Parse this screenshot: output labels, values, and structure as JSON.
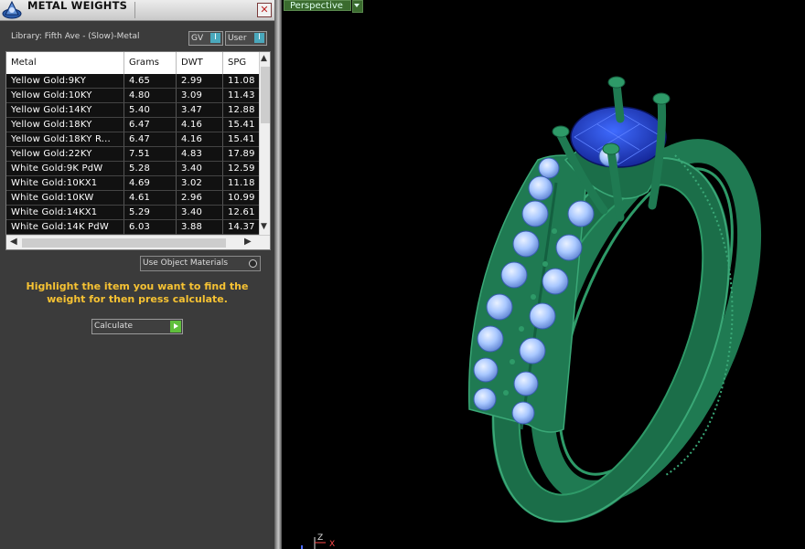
{
  "panel": {
    "title": "METAL WEIGHTS",
    "close_label": "✕",
    "library_label": "Library: Fifth Ave - (Slow)-Metal",
    "gv_toggle": "GV",
    "user_toggle": "User",
    "use_object_materials": "Use Object Materials",
    "instructions": "Highlight the item you want to find the weight for then press calculate.",
    "calculate_label": "Calculate"
  },
  "table": {
    "columns": [
      "Metal",
      "Grams",
      "DWT",
      "SPG"
    ],
    "rows": [
      [
        "Yellow Gold:9KY",
        "4.65",
        "2.99",
        "11.08"
      ],
      [
        "Yellow Gold:10KY",
        "4.80",
        "3.09",
        "11.43"
      ],
      [
        "Yellow Gold:14KY",
        "5.40",
        "3.47",
        "12.88"
      ],
      [
        "Yellow Gold:18KY",
        "6.47",
        "4.16",
        "15.41"
      ],
      [
        "Yellow Gold:18KY R...",
        "6.47",
        "4.16",
        "15.41"
      ],
      [
        "Yellow Gold:22KY",
        "7.51",
        "4.83",
        "17.89"
      ],
      [
        "White Gold:9K PdW",
        "5.28",
        "3.40",
        "12.59"
      ],
      [
        "White Gold:10KX1",
        "4.69",
        "3.02",
        "11.18"
      ],
      [
        "White Gold:10KW",
        "4.61",
        "2.96",
        "10.99"
      ],
      [
        "White Gold:14KX1",
        "5.29",
        "3.40",
        "12.61"
      ],
      [
        "White Gold:14K PdW",
        "6.03",
        "3.88",
        "14.37"
      ]
    ]
  },
  "viewport": {
    "view_mode": "Perspective",
    "axis_z": "Z",
    "axis_x": "X"
  },
  "colors": {
    "ring_green": "#1f7a52",
    "gem_blue": "#1a2fb0",
    "diamond": "#a9c8ff",
    "instruction_yellow": "#f6c233"
  }
}
